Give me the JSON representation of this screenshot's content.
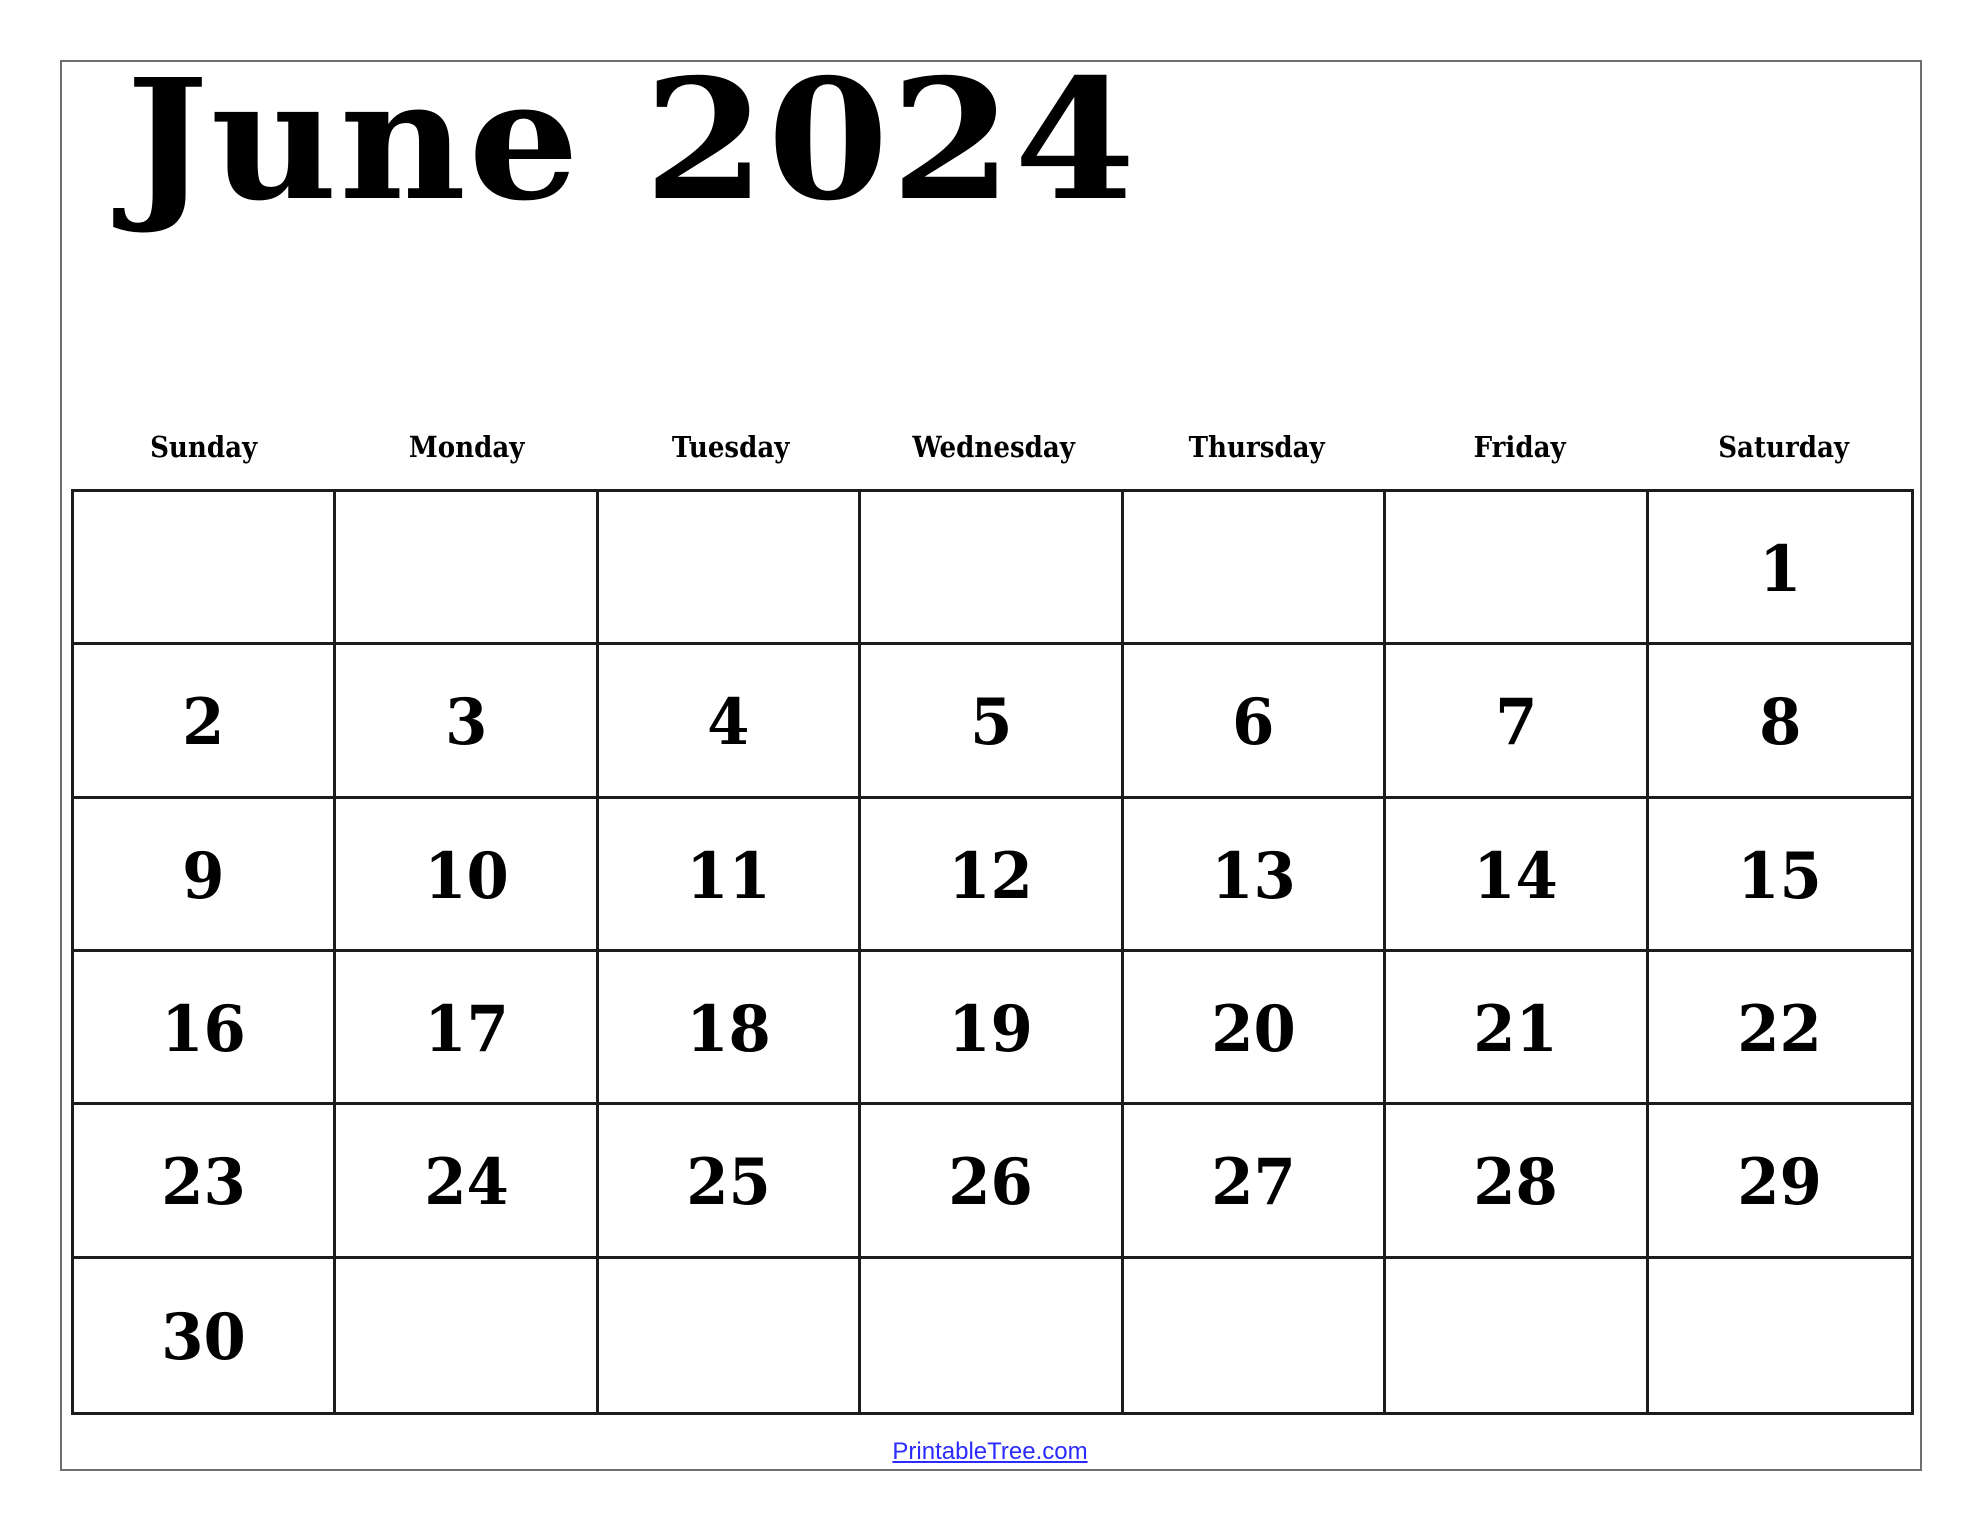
{
  "calendar": {
    "title": "June 2024",
    "month": "June",
    "year": 2024,
    "weekdays": [
      "Sunday",
      "Monday",
      "Tuesday",
      "Wednesday",
      "Thursday",
      "Friday",
      "Saturday"
    ],
    "weeks": [
      [
        "",
        "",
        "",
        "",
        "",
        "",
        "1"
      ],
      [
        "2",
        "3",
        "4",
        "5",
        "6",
        "7",
        "8"
      ],
      [
        "9",
        "10",
        "11",
        "12",
        "13",
        "14",
        "15"
      ],
      [
        "16",
        "17",
        "18",
        "19",
        "20",
        "21",
        "22"
      ],
      [
        "23",
        "24",
        "25",
        "26",
        "27",
        "28",
        "29"
      ],
      [
        "30",
        "",
        "",
        "",
        "",
        "",
        ""
      ]
    ]
  },
  "footer": {
    "link_text": "PrintableTree.com"
  },
  "colors": {
    "text": "#000000",
    "grid_lines": "#1c1c1c",
    "page_border": "#6e6e6e",
    "link": "#2b2bff"
  }
}
